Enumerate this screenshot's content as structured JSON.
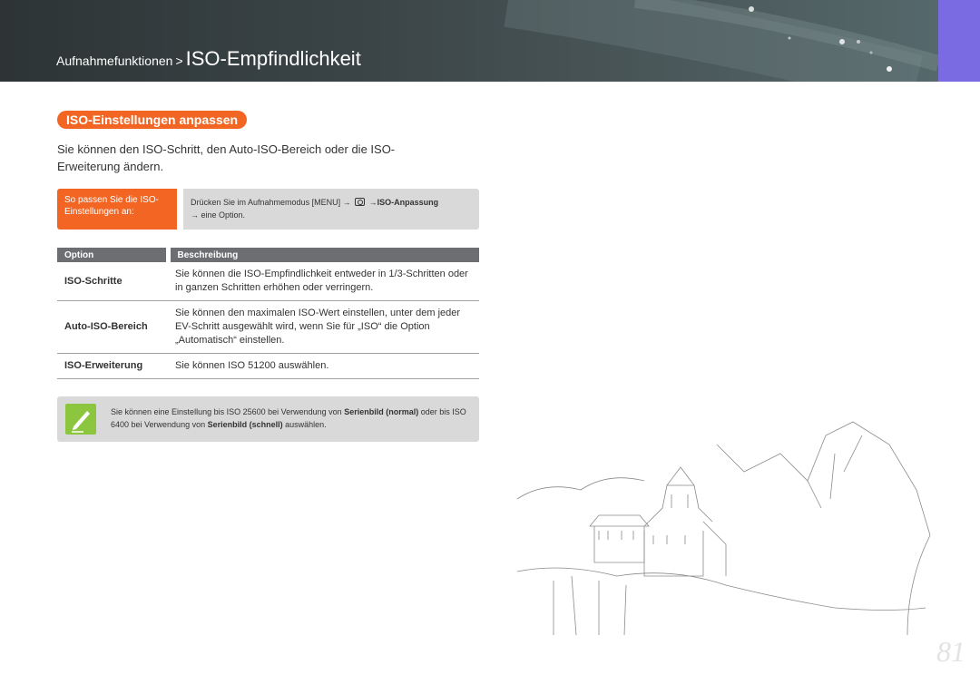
{
  "header": {
    "breadcrumb_parent": "Aufnahmefunktionen",
    "breadcrumb_separator": ">",
    "title": "ISO-Empfindlichkeit",
    "accent_color": "#7b6be3"
  },
  "section": {
    "heading": "ISO-Einstellungen anpassen",
    "intro": "Sie können den ISO-Schritt, den Auto-ISO-Bereich oder die ISO-Erweiterung ändern."
  },
  "howto": {
    "label": "So passen Sie die ISO-Einstellungen an:",
    "step_prefix": "Drücken Sie im Aufnahmemodus",
    "menu_key": "[MENU]",
    "arrow": "→",
    "camera_icon": "camera-icon",
    "setting": "ISO-Anpassung",
    "step_suffix": "→ eine Option."
  },
  "table": {
    "headers": [
      "Option",
      "Beschreibung"
    ],
    "rows": [
      {
        "option": "ISO-Schritte",
        "description": "Sie können die ISO-Empfindlichkeit entweder in 1/3-Schritten oder in ganzen Schritten erhöhen oder verringern."
      },
      {
        "option": "Auto-ISO-Bereich",
        "description": "Sie können den maximalen ISO-Wert einstellen, unter dem jeder EV-Schritt ausgewählt wird, wenn Sie für „ISO“ die Option „Automatisch“ einstellen."
      },
      {
        "option": "ISO-Erweiterung",
        "description": "Sie können ISO 51200 auswählen."
      }
    ]
  },
  "note": {
    "icon": "pen-note-icon",
    "text_1": "Sie können eine Einstellung bis ISO 25600 bei Verwendung von",
    "bold_1": "Serienbild (normal)",
    "text_2": "oder bis ISO 6400 bei Verwendung von",
    "bold_2": "Serienbild (schnell)",
    "text_3": "auswählen."
  },
  "page_number": "81",
  "colors": {
    "orange": "#f26522",
    "gray_panel": "#d9d9d9",
    "table_header": "#6d6e71",
    "note_icon": "#8cc63f"
  }
}
